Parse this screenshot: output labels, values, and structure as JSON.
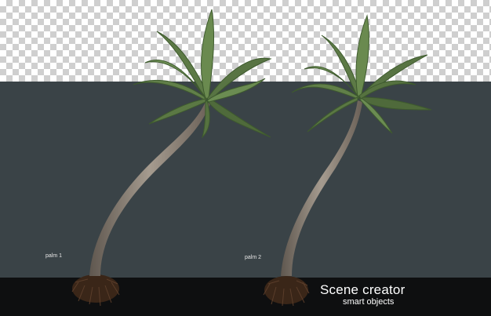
{
  "labels": {
    "palm1": "palm 1",
    "palm2": "palm 2"
  },
  "brand": {
    "title": "Scene creator",
    "subtitle": "smart objects"
  },
  "colors": {
    "panel": "#3a4347",
    "floor": "#0e0f10",
    "frond": "#5d7a46",
    "trunk": "#8a7f74"
  }
}
